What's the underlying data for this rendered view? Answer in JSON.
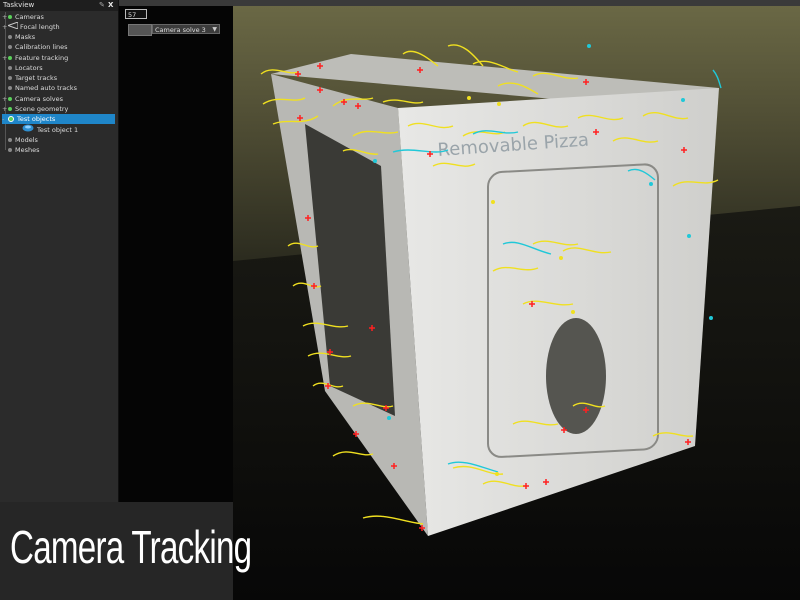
{
  "taskview": {
    "title": "Taskview",
    "pin_icon": "pin-icon",
    "close_label": "X",
    "items": [
      {
        "label": "Cameras",
        "dot": "green",
        "expand": "+"
      },
      {
        "label": "Focal length",
        "dot": "camera",
        "expand": "+"
      },
      {
        "label": "Masks",
        "dot": "grey",
        "expand": ""
      },
      {
        "label": "Calibration lines",
        "dot": "grey",
        "expand": ""
      },
      {
        "label": "Feature tracking",
        "dot": "green",
        "expand": "+"
      },
      {
        "label": "Locators",
        "dot": "grey",
        "expand": ""
      },
      {
        "label": "Target tracks",
        "dot": "grey",
        "expand": ""
      },
      {
        "label": "Named auto tracks",
        "dot": "grey",
        "expand": ""
      },
      {
        "label": "Camera solves",
        "dot": "green",
        "expand": "+"
      },
      {
        "label": "Scene geometry",
        "dot": "green",
        "expand": "+"
      },
      {
        "label": "Test objects",
        "dot": "green",
        "expand": "-"
      },
      {
        "label": "Test object 1",
        "dot": "object",
        "expand": ""
      },
      {
        "label": "Models",
        "dot": "grey",
        "expand": ""
      },
      {
        "label": "Meshes",
        "dot": "grey",
        "expand": ""
      }
    ]
  },
  "viewer": {
    "frame_number": "57",
    "camera_solve": "Camera solve 3"
  },
  "caption": "Camera Tracking",
  "colors": {
    "selection": "#1f86c9",
    "track_yellow": "#f0e020",
    "marker_red": "#ff2020",
    "track_cyan": "#20c8d8"
  }
}
